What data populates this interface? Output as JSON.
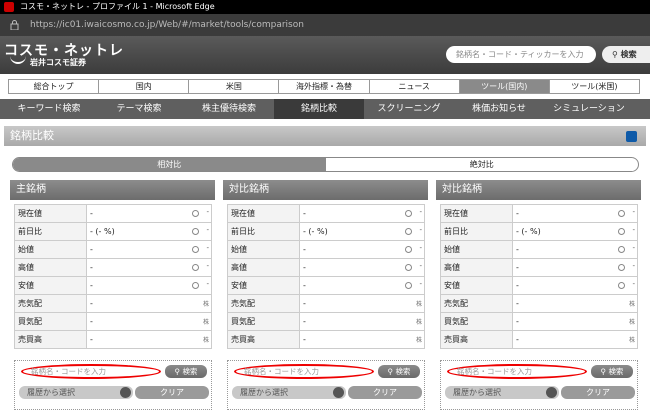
{
  "browser": {
    "title": "コスモ・ネットレ - プロファイル 1 - Microsoft Edge",
    "url": "https://ic01.iwaicosmo.co.jp/Web/#/market/tools/comparison"
  },
  "header": {
    "logo_main": "コスモ・ネットレ",
    "logo_sub": "岩井コスモ証券",
    "search_placeholder": "銘柄名・コード・ティッカーを入力",
    "search_button": "検索"
  },
  "gnav": [
    "総合トップ",
    "国内",
    "米国",
    "海外指標・為替",
    "ニュース",
    "ツール(国内)",
    "ツール(米国)"
  ],
  "snav": [
    "キーワード検索",
    "テーマ検索",
    "株主優待検索",
    "銘柄比較",
    "スクリーニング",
    "株価お知らせ",
    "シミュレーション"
  ],
  "section": {
    "title": "銘柄比較"
  },
  "toggle": {
    "relative": "相対比",
    "absolute": "絶対比"
  },
  "panels": [
    {
      "title": "主銘柄",
      "rows": [
        {
          "label": "現在値",
          "value": "-"
        },
        {
          "label": "前日比",
          "value": "- (- %)"
        },
        {
          "label": "始値",
          "value": "-"
        },
        {
          "label": "高値",
          "value": "-"
        },
        {
          "label": "安値",
          "value": "-"
        },
        {
          "label": "売気配",
          "value": "-"
        },
        {
          "label": "買気配",
          "value": "-"
        },
        {
          "label": "売買高",
          "value": "-"
        }
      ],
      "input_placeholder": "銘柄名・コードを入力",
      "search": "検索",
      "history": "履歴から選択",
      "clear": "クリア"
    },
    {
      "title": "対比銘柄",
      "rows": [
        {
          "label": "現在値",
          "value": "-"
        },
        {
          "label": "前日比",
          "value": "- (- %)"
        },
        {
          "label": "始値",
          "value": "-"
        },
        {
          "label": "高値",
          "value": "-"
        },
        {
          "label": "安値",
          "value": "-"
        },
        {
          "label": "売気配",
          "value": "-"
        },
        {
          "label": "買気配",
          "value": "-"
        },
        {
          "label": "売買高",
          "value": "-"
        }
      ],
      "input_placeholder": "銘柄名・コードを入力",
      "search": "検索",
      "history": "履歴から選択",
      "clear": "クリア"
    },
    {
      "title": "対比銘柄",
      "rows": [
        {
          "label": "現在値",
          "value": "-"
        },
        {
          "label": "前日比",
          "value": "- (- %)"
        },
        {
          "label": "始値",
          "value": "-"
        },
        {
          "label": "高値",
          "value": "-"
        },
        {
          "label": "安値",
          "value": "-"
        },
        {
          "label": "売気配",
          "value": "-"
        },
        {
          "label": "買気配",
          "value": "-"
        },
        {
          "label": "売買高",
          "value": "-"
        }
      ],
      "input_placeholder": "銘柄名・コードを入力",
      "search": "検索",
      "history": "履歴から選択",
      "clear": "クリア"
    }
  ],
  "suffix": {
    "dash": "-",
    "kabu": "株"
  }
}
